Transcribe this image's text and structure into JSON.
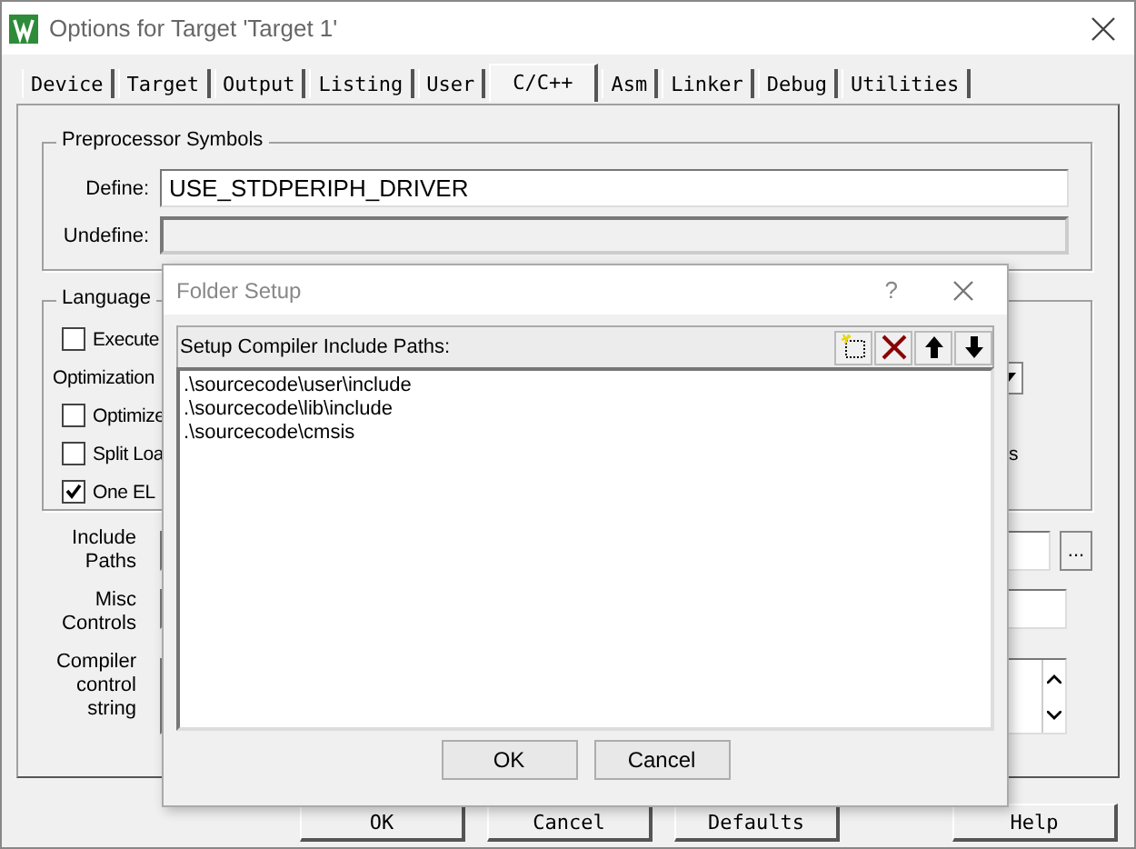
{
  "window": {
    "title": "Options for Target 'Target 1'"
  },
  "tabs": [
    {
      "label": "Device",
      "selected": false
    },
    {
      "label": "Target",
      "selected": false
    },
    {
      "label": "Output",
      "selected": false
    },
    {
      "label": "Listing",
      "selected": false
    },
    {
      "label": "User",
      "selected": false
    },
    {
      "label": "C/C++",
      "selected": true
    },
    {
      "label": "Asm",
      "selected": false
    },
    {
      "label": "Linker",
      "selected": false
    },
    {
      "label": "Debug",
      "selected": false
    },
    {
      "label": "Utilities",
      "selected": false
    }
  ],
  "preprocessor": {
    "title": "Preprocessor Symbols",
    "define_label": "Define:",
    "define_value": "USE_STDPERIPH_DRIVER",
    "undefine_label": "Undefine:",
    "undefine_disabled": true
  },
  "language_group": {
    "title": "Language",
    "rows": [
      {
        "kind": "checkbox",
        "label": "Execute",
        "checked": false
      },
      {
        "kind": "heading",
        "label": "Optimization",
        "trailing": {
          "kind": "dropdown"
        }
      },
      {
        "kind": "checkbox",
        "label": "Optimize",
        "checked": false
      },
      {
        "kind": "checkbox",
        "label": "Split Loa",
        "checked": false,
        "trailing": {
          "kind": "text",
          "text": "s"
        }
      },
      {
        "kind": "checkbox",
        "label": "One EL",
        "checked": true
      }
    ]
  },
  "fields": [
    {
      "label": "Include Paths",
      "kind": "browse",
      "button": "..."
    },
    {
      "label": "Misc Controls",
      "kind": "input"
    },
    {
      "label": "Compiler control string",
      "kind": "textarea"
    }
  ],
  "buttons": [
    "OK",
    "Cancel",
    "Defaults",
    "Help"
  ],
  "folder_setup": {
    "title": "Folder Setup",
    "help": "?",
    "list_label": "Setup Compiler Include Paths:",
    "paths": [
      ".\\sourcecode\\user\\include",
      ".\\sourcecode\\lib\\include",
      ".\\sourcecode\\cmsis"
    ],
    "buttons": [
      "OK",
      "Cancel"
    ]
  }
}
